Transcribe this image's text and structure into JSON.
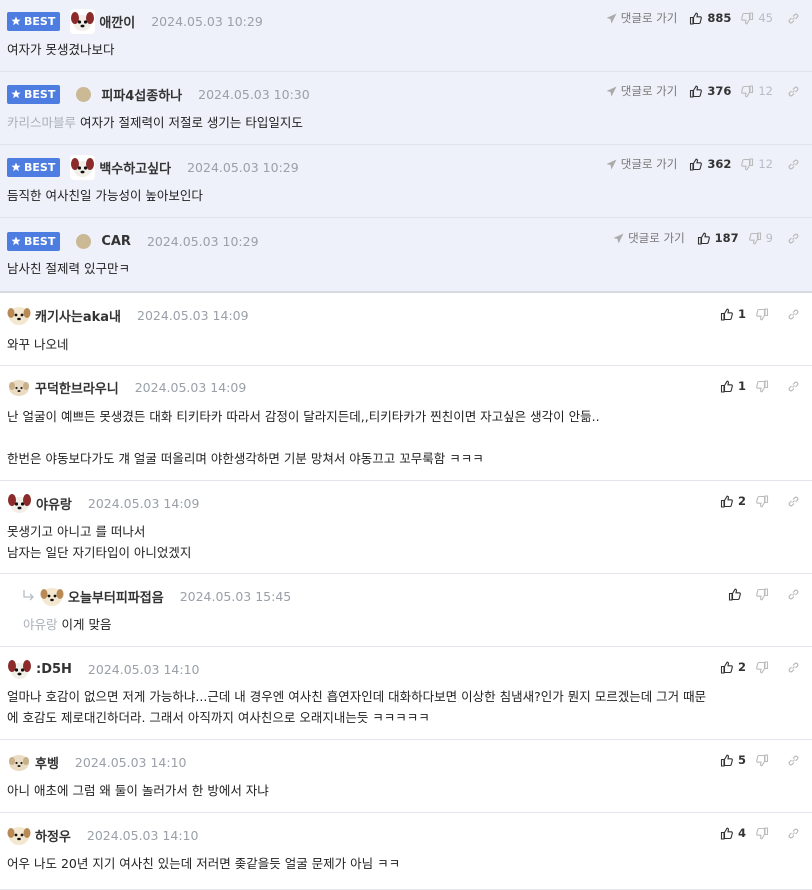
{
  "labels": {
    "best": "BEST",
    "reply_link": "댓글로 가기"
  },
  "colors": {
    "best_bg": "#eef1f9",
    "badge": "#4d7de0",
    "muted": "#9aa0a8"
  },
  "best_comments": [
    {
      "nick": "애깐이",
      "date": "2024.05.03 10:29",
      "text": "여자가 못생겼나보다",
      "up": "885",
      "down": "45",
      "avatar": "dog-face"
    },
    {
      "nick": "피파4섭종하나",
      "date": "2024.05.03 10:30",
      "mention": "카리스마블루",
      "text": "여자가 절제력이 저절로 생기는 타입일지도",
      "up": "376",
      "down": "12",
      "avatar": "level-dot"
    },
    {
      "nick": "백수하고싶다",
      "date": "2024.05.03 10:29",
      "text": "듬직한 여사친일 가능성이 높아보인다",
      "up": "362",
      "down": "12",
      "avatar": "dog-face"
    },
    {
      "nick": "CAR",
      "date": "2024.05.03 10:29",
      "text": "남사친 절제력 있구만ㅋ",
      "up": "187",
      "down": "9",
      "avatar": "level-dot"
    }
  ],
  "comments": [
    {
      "nick": "캐기사는aka내",
      "date": "2024.05.03 14:09",
      "text": "와꾸 나오네",
      "up": "1"
    },
    {
      "nick": "꾸덕한브라우니",
      "date": "2024.05.03 14:09",
      "text": "난 얼굴이 예쁘든 못생겼든 대화 티키타카 따라서 감정이 달라지든데,,티키타카가 찐친이면 자고싶은 생각이 안듦..\n\n한번은 야동보다가도 걔 얼굴 떠올리며 야한생각하면 기분 망쳐서 야동끄고 꼬무룩함 ㅋㅋㅋ",
      "up": "1"
    },
    {
      "nick": "야유랑",
      "date": "2024.05.03 14:09",
      "text": "못생기고 아니고 를 떠나서\n남자는 일단 자기타입이 아니었겠지",
      "up": "2"
    },
    {
      "nick": "오늘부터피파접음",
      "date": "2024.05.03 15:45",
      "mention": "야유랑",
      "text": "이게 맞음",
      "up": ""
    },
    {
      "nick": ":D5H",
      "date": "2024.05.03 14:10",
      "text": "얼마나 호감이 없으면 저게 가능하냐...근데 내 경우엔 여사친 흡연자인데 대화하다보면 이상한 침냄새?인가 뭔지 모르겠는데 그거 때문\n에 호감도 제로대긴하더라. 그래서 아직까지 여사친으로 오래지내는듯 ㅋㅋㅋㅋㅋ",
      "up": "2"
    },
    {
      "nick": "후벵",
      "date": "2024.05.03 14:10",
      "text": "아니 애초에 그럼 왜 둘이 놀러가서 한 방에서 자냐",
      "up": "5"
    },
    {
      "nick": "하정우",
      "date": "2024.05.03 14:10",
      "text": "어우 나도 20년 지기 여사친 있는데 저러면 좆같을듯 얼굴 문제가 아님 ㅋㅋ",
      "up": "4"
    }
  ]
}
